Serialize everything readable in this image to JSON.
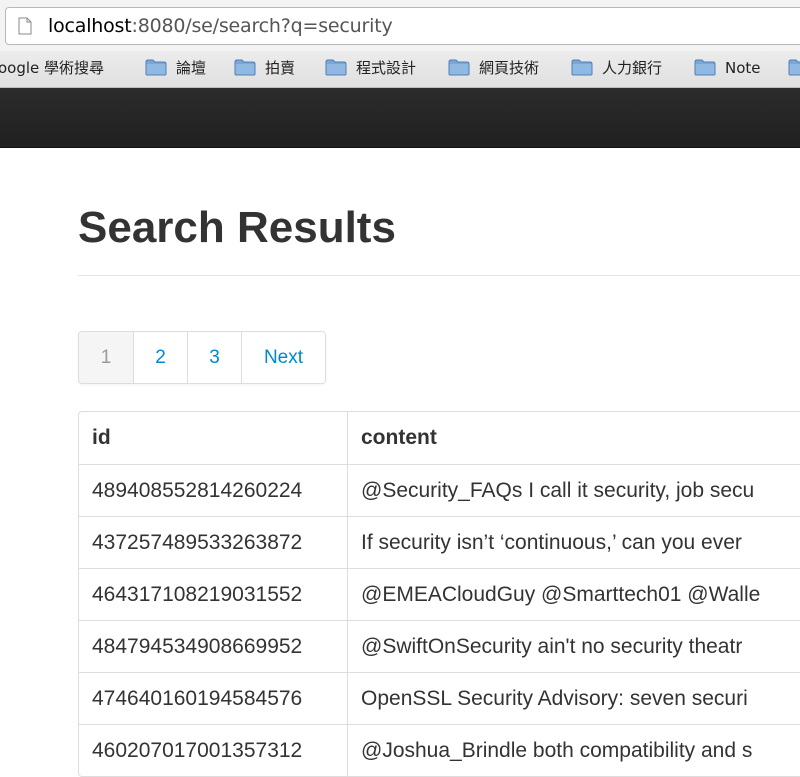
{
  "browser": {
    "url_host": "localhost",
    "url_rest": ":8080/se/search?q=security",
    "bookmarks": [
      {
        "label": "oogle 學術搜尋",
        "icon": null
      },
      {
        "label": "論壇",
        "icon": "folder-icon"
      },
      {
        "label": "拍賣",
        "icon": "folder-icon"
      },
      {
        "label": "程式設計",
        "icon": "folder-icon"
      },
      {
        "label": "網頁技術",
        "icon": "folder-icon"
      },
      {
        "label": "人力銀行",
        "icon": "folder-icon"
      },
      {
        "label": "Note",
        "icon": "folder-icon"
      }
    ]
  },
  "page": {
    "title": "Search Results"
  },
  "pagination": {
    "items": [
      {
        "label": "1",
        "active": true
      },
      {
        "label": "2",
        "active": false
      },
      {
        "label": "3",
        "active": false
      },
      {
        "label": "Next",
        "active": false
      }
    ]
  },
  "table": {
    "headers": [
      "id",
      "content"
    ],
    "rows": [
      [
        "489408552814260224",
        "@Security_FAQs I call it security, job secu"
      ],
      [
        "437257489533263872",
        "If security isn’t ‘continuous,’ can you ever"
      ],
      [
        "464317108219031552",
        "@EMEACloudGuy @Smarttech01 @Walle"
      ],
      [
        "484794534908669952",
        "@SwiftOnSecurity ain't no security theatr"
      ],
      [
        "474640160194584576",
        "OpenSSL Security Advisory: seven securi"
      ],
      [
        "460207017001357312",
        "@Joshua_Brindle both compatibility and s"
      ]
    ]
  },
  "colors": {
    "link": "#0088cc",
    "navbar": "#222222",
    "folder": "#6f9fd0"
  }
}
